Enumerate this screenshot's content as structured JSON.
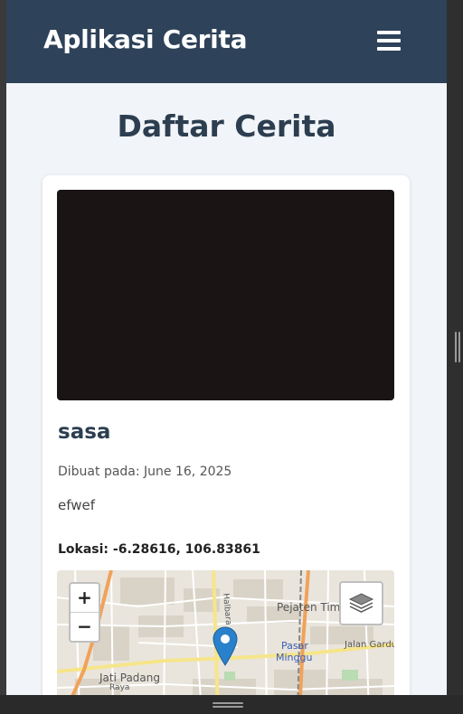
{
  "app": {
    "brand": "Aplikasi Cerita",
    "menu_icon": "hamburger-icon"
  },
  "page": {
    "title": "Daftar Cerita"
  },
  "story": {
    "name": "sasa",
    "date_text": "Dibuat pada: June 16, 2025",
    "description": "efwef",
    "location_text": "Lokasi: -6.28616, 106.83861"
  },
  "map": {
    "zoom_in_label": "+",
    "zoom_out_label": "−",
    "layers_icon": "layers-icon",
    "marker_icon": "map-pin-icon",
    "labels": {
      "pejaten": "Pejaten Tim",
      "pasar": "Pasar",
      "minggu": "Minggu",
      "jati": "Jati Padang",
      "jalan": "Jalan Gardu",
      "raya": "Raya",
      "halbara": "Halbara"
    }
  },
  "colors": {
    "navbar": "#2e4259",
    "page_bg": "#f1f5f9",
    "title": "#2c3e50",
    "marker": "#2a81cb"
  }
}
